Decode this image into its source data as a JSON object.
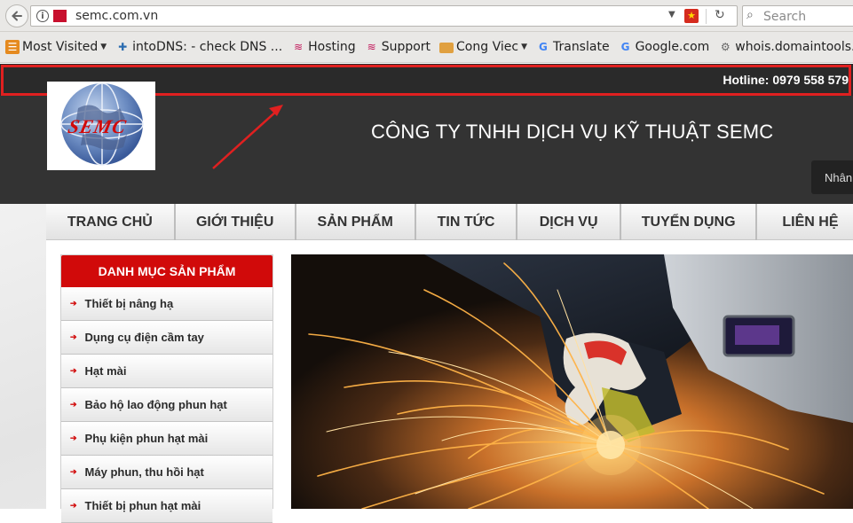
{
  "browser": {
    "url": "semc.com.vn",
    "search_placeholder": "Search",
    "bookmarks": [
      {
        "label": "Most Visited",
        "icon": "most-visited-icon",
        "has_menu": true
      },
      {
        "label": "intoDNS: - check DNS ...",
        "icon": "intodns-icon",
        "has_menu": false
      },
      {
        "label": "Hosting",
        "icon": "hosting-icon",
        "has_menu": false
      },
      {
        "label": "Support",
        "icon": "support-icon",
        "has_menu": false
      },
      {
        "label": "Cong Viec",
        "icon": "folder-icon",
        "has_menu": true
      },
      {
        "label": "Translate",
        "icon": "google-icon",
        "has_menu": false
      },
      {
        "label": "Google.com",
        "icon": "google-icon",
        "has_menu": false
      },
      {
        "label": "whois.domaintools.com",
        "icon": "whois-icon",
        "has_menu": false
      }
    ]
  },
  "site": {
    "hotline": "Hotline: 0979 558 579",
    "company_name": "CÔNG TY TNHH DỊCH VỤ KỸ THUẬT SEMC",
    "logo_text": "SEMC",
    "header_button": "Nhân",
    "nav": [
      "TRANG CHỦ",
      "GIỚI THIỆU",
      "SẢN PHẨM",
      "TIN TỨC",
      "DỊCH VỤ",
      "TUYỂN DỤNG",
      "LIÊN HỆ"
    ],
    "sidebar": {
      "title": "DANH MỤC SẢN PHẨM",
      "items": [
        "Thiết bị nâng hạ",
        "Dụng cụ điện cầm tay",
        "Hạt mài",
        "Bảo hộ lao động phun hạt",
        "Phụ kiện phun hạt mài",
        "Máy phun, thu hồi hạt",
        "Thiết bị phun hạt mài"
      ]
    }
  },
  "colors": {
    "accent_red": "#d10a0a",
    "annotation_red": "#e02020",
    "header_dark": "#333333"
  }
}
